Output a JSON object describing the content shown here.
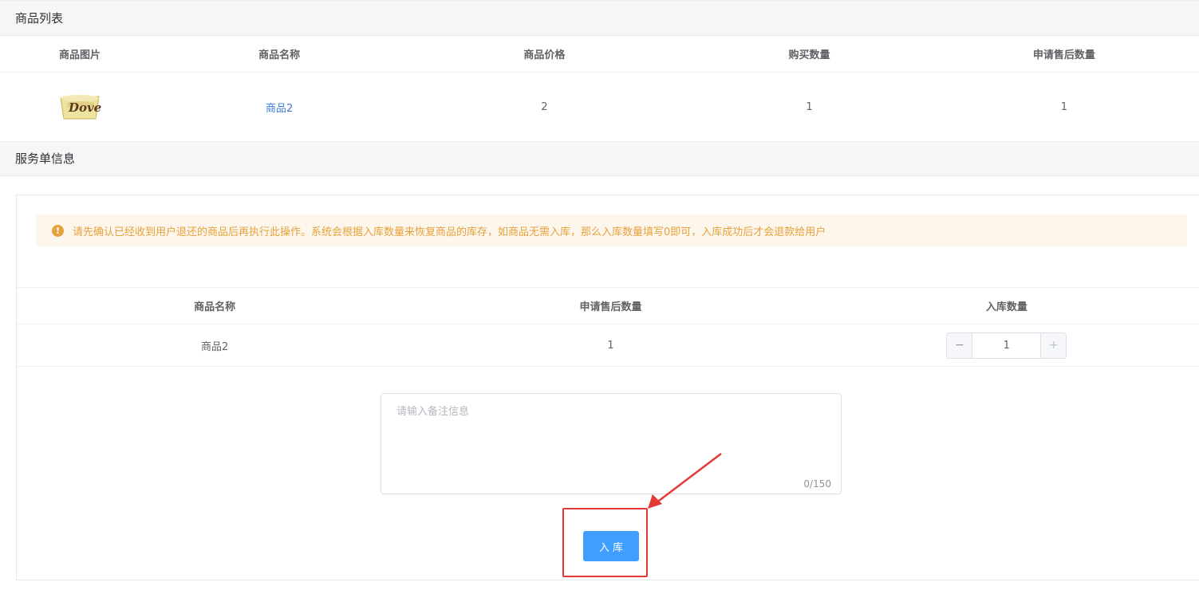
{
  "product_list": {
    "title": "商品列表",
    "headers": [
      "商品图片",
      "商品名称",
      "商品价格",
      "购买数量",
      "申请售后数量"
    ],
    "row": {
      "image_text": "Dove",
      "name": "商品2",
      "price": "2",
      "buy_qty": "1",
      "after_sale_qty": "1"
    }
  },
  "service_info": {
    "title": "服务单信息",
    "alert": "请先确认已经收到用户退还的商品后再执行此操作。系统会根据入库数量来恢复商品的库存，如商品无需入库，那么入库数量填写0即可，入库成功后才会退款给用户",
    "alert_icon": "warning-icon",
    "table": {
      "headers": [
        "商品名称",
        "申请售后数量",
        "入库数量"
      ],
      "row": {
        "name": "商品2",
        "after_sale_qty": "1",
        "stock_in_qty": "1"
      }
    },
    "remark": {
      "placeholder": "请输入备注信息",
      "counter": "0/150"
    },
    "submit_label": "入 库"
  },
  "colors": {
    "primary": "#409eff",
    "warning": "#e6a23c",
    "annotation": "#e53935"
  }
}
